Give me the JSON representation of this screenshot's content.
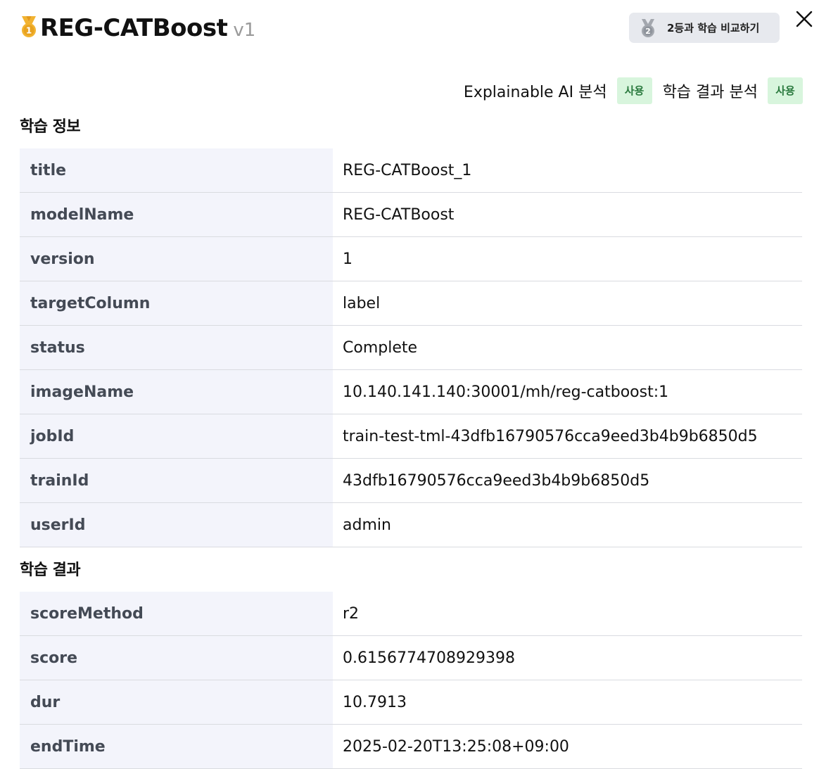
{
  "header": {
    "title": "REG-CATBoost",
    "version": "v1"
  },
  "compare": {
    "label": "2등과 학습 비교하기"
  },
  "analysis": {
    "items": [
      {
        "label": "Explainable AI 분석",
        "badge": "사용"
      },
      {
        "label": "학습 결과 분석",
        "badge": "사용"
      }
    ]
  },
  "train_info": {
    "heading": "학습 정보",
    "rows": [
      {
        "key": "title",
        "value": "REG-CATBoost_1"
      },
      {
        "key": "modelName",
        "value": "REG-CATBoost"
      },
      {
        "key": "version",
        "value": "1"
      },
      {
        "key": "targetColumn",
        "value": "label"
      },
      {
        "key": "status",
        "value": "Complete"
      },
      {
        "key": "imageName",
        "value": "10.140.141.140:30001/mh/reg-catboost:1"
      },
      {
        "key": "jobId",
        "value": "train-test-tml-43dfb16790576cca9eed3b4b9b6850d5"
      },
      {
        "key": "trainId",
        "value": "43dfb16790576cca9eed3b4b9b6850d5"
      },
      {
        "key": "userId",
        "value": "admin"
      }
    ]
  },
  "train_result": {
    "heading": "학습 결과",
    "rows": [
      {
        "key": "scoreMethod",
        "value": "r2"
      },
      {
        "key": "score",
        "value": "0.6156774708929398"
      },
      {
        "key": "dur",
        "value": "10.7913"
      },
      {
        "key": "endTime",
        "value": "2025-02-20T13:25:08+09:00"
      }
    ]
  },
  "colors": {
    "gold_medal": "#f2b330",
    "silver_medal": "#a3a7ae",
    "badge_bg": "#d8f5dd",
    "badge_text": "#2a7a3e",
    "key_cell_bg": "#f3f4fb",
    "compare_button_bg": "#e7e9ee"
  },
  "icons": {
    "gold": "gold-medal-icon",
    "silver": "silver-medal-icon",
    "close": "close-icon"
  }
}
